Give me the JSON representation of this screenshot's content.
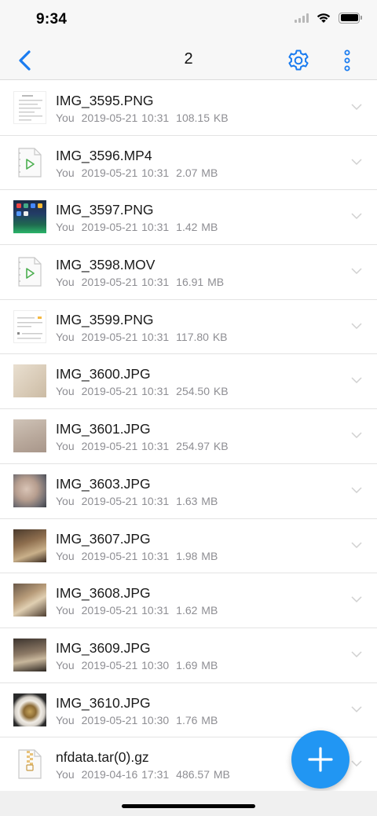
{
  "status_bar": {
    "time": "9:34"
  },
  "nav_bar": {
    "title": "2",
    "back_icon": "chevron-left-icon",
    "settings_icon": "gear-icon",
    "more_icon": "vertical-ellipsis-icon",
    "accent_color": "#1a7cf0"
  },
  "files": [
    {
      "name": "IMG_3595.PNG",
      "owner": "You",
      "modified": "2019-05-21 10:31",
      "size": "108.15 KB",
      "thumb": "document-screenshot"
    },
    {
      "name": "IMG_3596.MP4",
      "owner": "You",
      "modified": "2019-05-21 10:31",
      "size": "2.07 MB",
      "thumb": "video-file-icon"
    },
    {
      "name": "IMG_3597.PNG",
      "owner": "You",
      "modified": "2019-05-21 10:31",
      "size": "1.42 MB",
      "thumb": "phone-homescreen"
    },
    {
      "name": "IMG_3598.MOV",
      "owner": "You",
      "modified": "2019-05-21 10:31",
      "size": "16.91 MB",
      "thumb": "video-file-icon"
    },
    {
      "name": "IMG_3599.PNG",
      "owner": "You",
      "modified": "2019-05-21 10:31",
      "size": "117.80 KB",
      "thumb": "document-screenshot"
    },
    {
      "name": "IMG_3600.JPG",
      "owner": "You",
      "modified": "2019-05-21 10:31",
      "size": "254.50 KB",
      "thumb": "paper-photo"
    },
    {
      "name": "IMG_3601.JPG",
      "owner": "You",
      "modified": "2019-05-21 10:31",
      "size": "254.97 KB",
      "thumb": "paper-photo"
    },
    {
      "name": "IMG_3603.JPG",
      "owner": "You",
      "modified": "2019-05-21 10:31",
      "size": "1.63 MB",
      "thumb": "face-photo"
    },
    {
      "name": "IMG_3607.JPG",
      "owner": "You",
      "modified": "2019-05-21 10:31",
      "size": "1.98 MB",
      "thumb": "scene-photo"
    },
    {
      "name": "IMG_3608.JPG",
      "owner": "You",
      "modified": "2019-05-21 10:31",
      "size": "1.62 MB",
      "thumb": "scene-photo"
    },
    {
      "name": "IMG_3609.JPG",
      "owner": "You",
      "modified": "2019-05-21 10:30",
      "size": "1.69 MB",
      "thumb": "scene-photo"
    },
    {
      "name": "IMG_3610.JPG",
      "owner": "You",
      "modified": "2019-05-21 10:30",
      "size": "1.76 MB",
      "thumb": "plate-photo"
    },
    {
      "name": "nfdata.tar(0).gz",
      "owner": "You",
      "modified": "2019-04-16 17:31",
      "size": "486.57 MB",
      "thumb": "zip-archive-icon"
    }
  ],
  "fab": {
    "icon": "plus-icon",
    "color": "#2196f3"
  }
}
